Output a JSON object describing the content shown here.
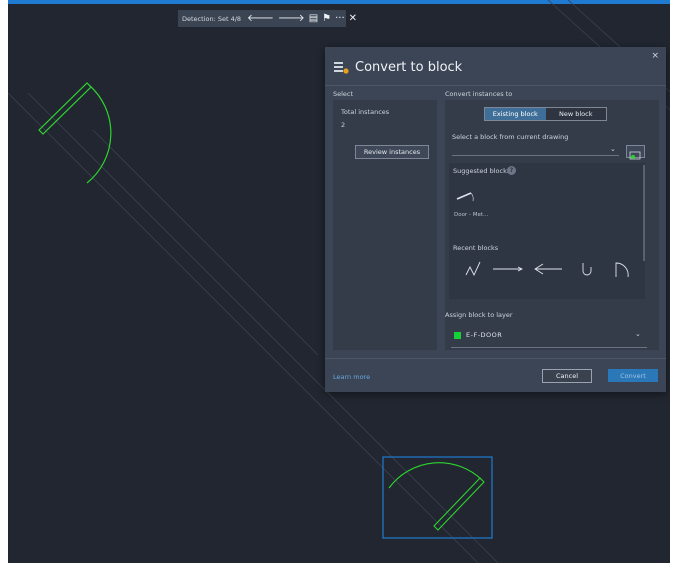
{
  "toolbar": {
    "detection_label": "Detection: Set 4/8",
    "icons": [
      "arrow-left-icon",
      "arrow-right-icon",
      "convert-block-icon",
      "flag-icon",
      "more-icon",
      "close-icon"
    ],
    "glyphs": {
      "prev": "🡐",
      "next": "🡒",
      "convert": "▤",
      "flag": "⚑",
      "more": "···",
      "close": "✕"
    }
  },
  "dialog": {
    "title": "Convert to block",
    "close_glyph": "×",
    "select": {
      "heading": "Select",
      "total_label": "Total instances",
      "total_value": "2",
      "review_button": "Review instances"
    },
    "convert_to": {
      "heading": "Convert instances to",
      "tabs": [
        {
          "label": "Existing block",
          "active": true
        },
        {
          "label": "New block",
          "active": false
        }
      ],
      "select_label": "Select a block from current drawing",
      "suggested_label": "Suggested blocks",
      "suggested_items": [
        {
          "name": "Door - Met..."
        }
      ],
      "recent_label": "Recent blocks",
      "recent_icons": [
        "zigzag-block-icon",
        "line-arrow-block-icon",
        "arrow-left-block-icon",
        "hook-block-icon",
        "arch-block-icon"
      ]
    },
    "assign_layer": {
      "label": "Assign block to layer",
      "layer_name": "E-F-DOOR",
      "layer_color": "#14d236"
    },
    "footer": {
      "learn_more": "Learn more",
      "cancel": "Cancel",
      "convert": "Convert"
    }
  },
  "colors": {
    "canvas": "#212630",
    "accent": "#1f7ad1",
    "door_green": "#2ed52e",
    "dialog_bg": "#3c4555"
  }
}
